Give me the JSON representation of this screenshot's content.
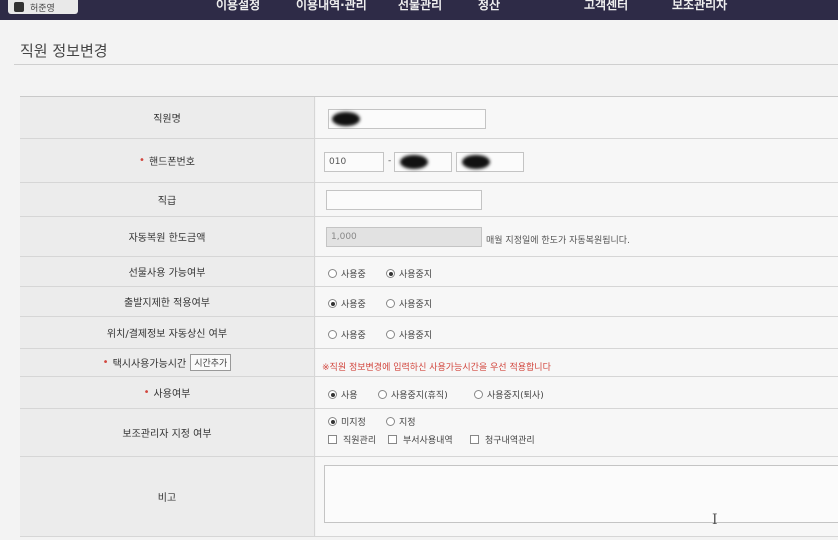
{
  "header": {
    "user_label": "허준영",
    "nav": [
      "이용설정",
      "이용내역·관리",
      "선물관리",
      "정산",
      "고객센터",
      "보조관리자"
    ]
  },
  "page_title": "직원 정보변경",
  "form": {
    "name_label": "직원명",
    "phone_label": "핸드폰번호",
    "phone_prefix": "010",
    "phone_sep": "-",
    "rank_label": "직급",
    "limit_label": "자동복원 한도금액",
    "limit_value": "1,000",
    "limit_note": "매월 지정일에 한도가 자동복원됩니다.",
    "gift_label": "선물사용 가능여부",
    "gift_options": [
      "사용중",
      "사용중지"
    ],
    "departure_label": "출발지제한 적용여부",
    "departure_options": [
      "사용중",
      "사용중지"
    ],
    "location_label": "위치/결제정보 자동상신 여부",
    "location_options": [
      "사용중",
      "사용중지"
    ],
    "taxi_label": "택시사용가능시간",
    "taxi_button": "시간추가",
    "taxi_note": "※직원 정보변경에 입력하신 사용가능시간을 우선 적용합니다",
    "usage_label": "사용여부",
    "usage_options": [
      "사용",
      "사용중지(휴직)",
      "사용중지(퇴사)"
    ],
    "sub_label": "보조관리자 지정 여부",
    "sub_options": [
      "미지정",
      "지정"
    ],
    "sub_checks": [
      "직원관리",
      "부서사용내역",
      "청구내역관리"
    ],
    "memo_label": "비고"
  },
  "cursor_glyph": "I"
}
